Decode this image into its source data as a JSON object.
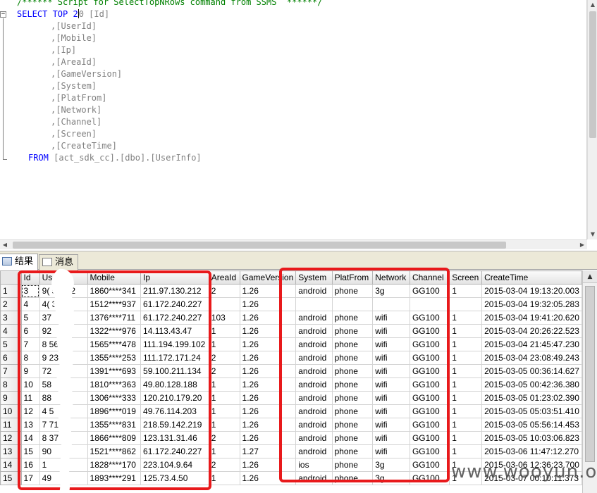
{
  "editor": {
    "comment": "/****** Script for SelectTopNRows command from SSMS  ******/",
    "select_kw": "SELECT TOP 2",
    "select_rest": "0 [Id]",
    "columns": [
      ",[UserId]",
      ",[Mobile]",
      ",[Ip]",
      ",[AreaId]",
      ",[GameVersion]",
      ",[System]",
      ",[PlatFrom]",
      ",[Network]",
      ",[Channel]",
      ",[Screen]",
      ",[CreateTime]"
    ],
    "from_kw": "FROM",
    "from_rest": "[act_sdk_cc].[dbo].[UserInfo]"
  },
  "tabs": [
    {
      "label": "结果",
      "icon": "results-grid-icon"
    },
    {
      "label": "消息",
      "icon": "messages-icon"
    }
  ],
  "grid": {
    "headers": [
      "Id",
      "UserId",
      "Mobile",
      "Ip",
      "AreaId",
      "GameVersion",
      "System",
      "PlatFrom",
      "Network",
      "Channel",
      "Screen",
      "CreateTime"
    ],
    "rows": [
      {
        "n": "1",
        "cells": [
          "3",
          "9(   57922",
          "1860****341",
          "211.97.130.212",
          "2",
          "1.26",
          "android",
          "phone",
          "3g",
          "GG100",
          "1",
          "2015-03-04 19:13:20.003"
        ]
      },
      {
        "n": "2",
        "cells": [
          "4",
          "4(    37",
          "1512****937",
          "61.172.240.227",
          "",
          "1.26",
          "",
          "",
          "",
          "",
          "",
          "2015-03-04 19:32:05.283"
        ]
      },
      {
        "n": "3",
        "cells": [
          "5",
          "      37",
          "1376****711",
          "61.172.240.227",
          "103",
          "1.26",
          "android",
          "phone",
          "wifi",
          "GG100",
          "1",
          "2015-03-04 19:41:20.620"
        ]
      },
      {
        "n": "4",
        "cells": [
          "6",
          "      92",
          "1322****976",
          "14.113.43.47",
          "1",
          "1.26",
          "android",
          "phone",
          "wifi",
          "GG100",
          "1",
          "2015-03-04 20:26:22.523"
        ]
      },
      {
        "n": "5",
        "cells": [
          "7",
          "8     56",
          "1565****478",
          "111.194.199.102",
          "1",
          "1.26",
          "android",
          "phone",
          "wifi",
          "GG100",
          "1",
          "2015-03-04 21:45:47.230"
        ]
      },
      {
        "n": "6",
        "cells": [
          "8",
          "9     23",
          "1355****253",
          "111.172.171.24",
          "2",
          "1.26",
          "android",
          "phone",
          "wifi",
          "GG100",
          "1",
          "2015-03-04 23:08:49.243"
        ]
      },
      {
        "n": "7",
        "cells": [
          "9",
          "      72",
          "1391****693",
          "59.100.211.134",
          "2",
          "1.26",
          "android",
          "phone",
          "wifi",
          "GG100",
          "1",
          "2015-03-05 00:36:14.627"
        ]
      },
      {
        "n": "8",
        "cells": [
          "10",
          "      58",
          "1810****363",
          "49.80.128.188",
          "1",
          "1.26",
          "android",
          "phone",
          "wifi",
          "GG100",
          "1",
          "2015-03-05 00:42:36.380"
        ]
      },
      {
        "n": "9",
        "cells": [
          "11",
          "      88",
          "1306****333",
          "120.210.179.20",
          "1",
          "1.26",
          "android",
          "phone",
          "wifi",
          "GG100",
          "1",
          "2015-03-05 01:23:02.390"
        ]
      },
      {
        "n": "10",
        "cells": [
          "12",
          "4      5",
          "1896****019",
          "49.76.114.203",
          "1",
          "1.26",
          "android",
          "phone",
          "wifi",
          "GG100",
          "1",
          "2015-03-05 05:03:51.410"
        ]
      },
      {
        "n": "11",
        "cells": [
          "13",
          "7     71",
          "1355****831",
          "218.59.142.219",
          "1",
          "1.26",
          "android",
          "phone",
          "wifi",
          "GG100",
          "1",
          "2015-03-05 05:56:14.453"
        ]
      },
      {
        "n": "12",
        "cells": [
          "14",
          "8     37",
          "1866****809",
          "123.131.31.46",
          "2",
          "1.26",
          "android",
          "phone",
          "wifi",
          "GG100",
          "1",
          "2015-03-05 10:03:06.823"
        ]
      },
      {
        "n": "13",
        "cells": [
          "15",
          "      90",
          "1521****862",
          "61.172.240.227",
          "1",
          "1.27",
          "android",
          "phone",
          "wifi",
          "GG100",
          "1",
          "2015-03-06 11:47:12.270"
        ]
      },
      {
        "n": "14",
        "cells": [
          "16",
          "      1",
          "1828****170",
          "223.104.9.64",
          "2",
          "1.26",
          "ios",
          "phone",
          "3g",
          "GG100",
          "1",
          "2015-03-06 12:36:23.700"
        ]
      },
      {
        "n": "15",
        "cells": [
          "17",
          "      49",
          "1893****291",
          "125.73.4.50",
          "1",
          "1.26",
          "android",
          "phone",
          "3g",
          "GG100",
          "1",
          "2015-03-07 00:10:11.373"
        ]
      }
    ]
  },
  "watermark": "www.wooyun.org",
  "colors": {
    "annotation_red": "#e8191b",
    "sql_keyword": "#0000ff",
    "sql_comment": "#008000"
  }
}
